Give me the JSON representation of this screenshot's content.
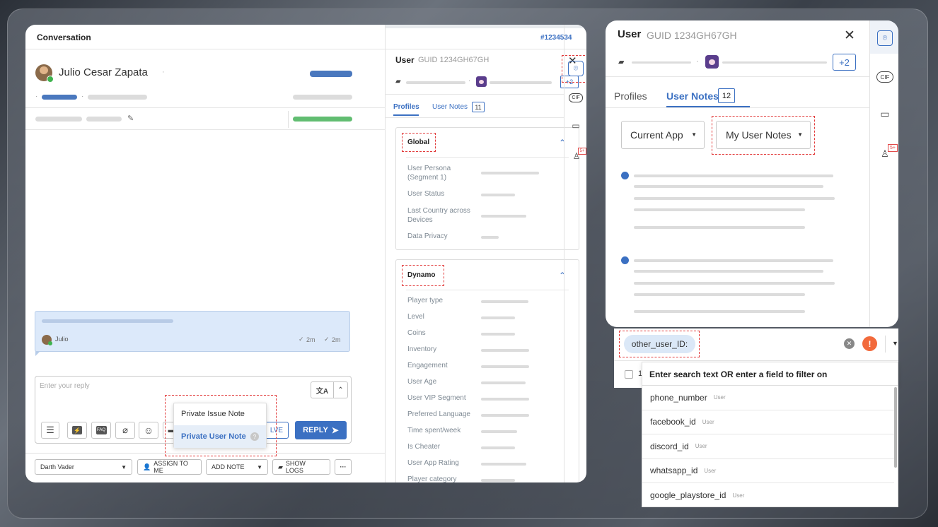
{
  "conversation": {
    "title": "Conversation",
    "ticket_id": "#1234534",
    "user_name": "Julio Cesar Zapata",
    "message_author": "Julio",
    "message_time1": "2m",
    "message_time2": "2m",
    "reply_placeholder": "Enter your reply",
    "popup_item1": "Private Issue Note",
    "popup_item2": "Private User Note",
    "solve_label": "LVE",
    "reply_label": "REPLY",
    "assignee": "Darth Vader",
    "assign_label": "ASSIGN TO ME",
    "add_note_label": "ADD NOTE",
    "show_logs_label": "SHOW LOGS"
  },
  "profile_panel": {
    "user_label": "User",
    "guid": "GUID 1234GH67GH",
    "plus_count": "+2",
    "tab_profiles": "Profiles",
    "tab_user_notes": "User Notes",
    "notes_count": "11",
    "global_title": "Global",
    "global_rows": [
      "User Persona (Segment 1)",
      "User Status",
      "Last Country across Devices",
      "Data Privacy"
    ],
    "dynamo_title": "Dynamo",
    "dynamo_rows": [
      "Player type",
      "Level",
      "Coins",
      "Inventory",
      "Engagement",
      "User Age",
      "User VIP Segment",
      "Preferred Language",
      "Time spent/week",
      "Is Cheater",
      "User App Rating",
      "Player category"
    ]
  },
  "rail": {
    "cif_label": "CIF",
    "badge": "5+"
  },
  "zoom_panel": {
    "user_label": "User",
    "guid": "GUID 1234GH67GH",
    "plus_count": "+2",
    "tab_profiles": "Profiles",
    "tab_user_notes": "User Notes",
    "notes_count": "12",
    "filter_app": "Current App",
    "filter_notes": "My User Notes"
  },
  "search_panel": {
    "chip": "other_user_ID:",
    "hint": "Enter search text OR enter a field to filter on",
    "row_prefix": "1",
    "fields": [
      {
        "name": "phone_number",
        "tag": "User"
      },
      {
        "name": "facebook_id",
        "tag": "User"
      },
      {
        "name": "discord_id",
        "tag": "User"
      },
      {
        "name": "whatsapp_id",
        "tag": "User"
      },
      {
        "name": "google_playstore_id",
        "tag": "User"
      }
    ]
  },
  "colors": {
    "accent": "#3b70c2",
    "highlight_dash": "#e23b3b",
    "online": "#3fb34f",
    "warning": "#f26a3c"
  }
}
